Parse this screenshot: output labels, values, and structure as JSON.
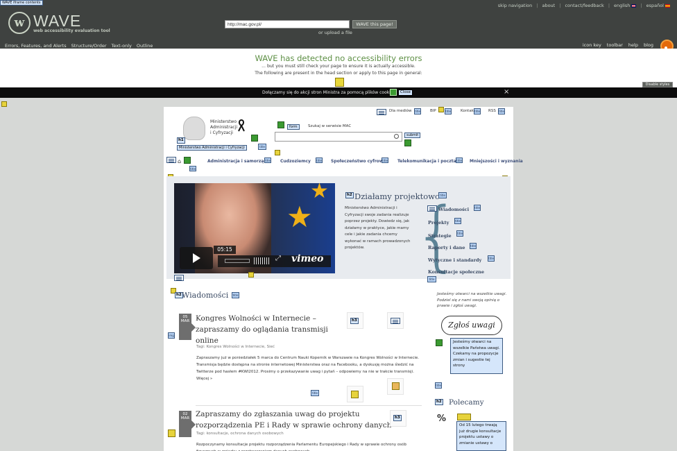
{
  "wave": {
    "logo_word": "WAVE",
    "logo_sub": "web accessibility evaluation tool",
    "top_links": [
      "skip navigation",
      "about",
      "contact/feedback",
      "english",
      "español"
    ],
    "url_value": "http://mac.gov.pl/",
    "submit_label": "WAVE this page!",
    "upload_link": "or upload a file",
    "nav_left": [
      "Errors, Features, and Alerts",
      "Structure/Order",
      "Text-only",
      "Outline"
    ],
    "nav_right": [
      "icon key",
      "toolbar",
      "help",
      "blog"
    ],
    "summary_title": "WAVE has detected no accessibility errors",
    "summary_sub": "... but you must still check your page to ensure it is actually accessible.",
    "summary_head": "The following are present in the head section or apply to this page in general:",
    "disable_label": "Disable styles",
    "colors": {
      "header_bg": "#3f4240",
      "success": "#5d8f44",
      "alert": "#e7d33c",
      "feature": "#3b9a31",
      "structure": "#b7d3f5"
    }
  },
  "cookie": {
    "text": "Dołączamy się do akcji stron Ministra za pomocą plików cookies",
    "close_tag": "Close"
  },
  "ministry": {
    "name_lines": [
      "Ministerstwo",
      "Administracji",
      "i Cyfryzacji"
    ],
    "h1_tag": "Ministerstwo Administracji i Cyfryzacji",
    "top_nav": [
      "Dla mediów",
      "BIP",
      "Kontakt",
      "RSS"
    ],
    "search_label_tag": "form",
    "search_label": "Szukaj w serwisie MAC",
    "search_button_tag": "submit",
    "main_nav": [
      "Administracja i samorząd",
      "Cudzoziemcy",
      "Społeczeństwo cyfrowe",
      "Telekomunikacja i poczta",
      "Mniejszości i wyznania"
    ]
  },
  "hero": {
    "title": "Działamy projektowo",
    "text": "Ministerstwo Administracji i Cyfryzacji swoje zadania realizuje poprzez projekty. Dowiedz się, jak działamy w praktyce, jakie mamy cele i jakie zadania chcemy wykonać w ramach prowadzonych projektów.",
    "links": [
      "Wiadomości",
      "Projekty",
      "Strategie",
      "Raporty i dane",
      "Wytyczne i standardy",
      "Konsultacje społeczne"
    ],
    "video_time": "05:15",
    "video_brand": "vimeo",
    "iframe_tag": "WAVE iframe contents"
  },
  "news": {
    "title": "Wiadomości",
    "items": [
      {
        "date_day": "05",
        "date_mon": "MAR",
        "head_lines": [
          "Kongres Wolności w Internecie –",
          "zapraszamy do oglądania transmisji",
          "online"
        ],
        "tags": "Tagi: Kongres Wolności w Internecie, Sieć",
        "body": "Zapraszamy już w poniedziałek 5 marca do Centrum Nauki Kopernik w Warszawie na Kongres Wolności w Internecie. Transmisja będzie dostępna na stronie internetowej Ministerstwa oraz na Facebooku, a dyskusję można śledzić na Twitterze pod hasłem #KWI2012. Prosimy o przekazywanie uwag i pytań – odpowiemy na nie w trakcie transmisji. Więcej »"
      },
      {
        "date_day": "02",
        "date_mon": "MAR",
        "head_lines": [
          "Zapraszamy do zgłaszania uwag do projektu",
          "rozporządzenia PE i Rady w sprawie ochrony danych"
        ],
        "tags": "Tagi: konsultacje, ochrona danych osobowych",
        "body": "Rozpoczynamy konsultacje projektu rozporządzenia Parlamentu Europejskiego i Rady w sprawie ochrony osób fizycznych w związku z przetwarzaniem danych osobowych."
      }
    ]
  },
  "sidebar": {
    "hand_text": "Jesteśmy otwarci na wszelkie uwagi. Podziel się z nami swoją opinią o prawie i zgłoś uwagi.",
    "zglos": "Zgłoś uwagi",
    "info_box": "Jesteśmy otwarci na wszelkie Państwa uwagi. Czekamy na propozycje zmian i sugestie tej strony",
    "polecamy": "Polecamy",
    "info_box2": "Od 15 lutego trwają już drugie konsultacje projektu ustawy o zmianie ustawy o"
  },
  "wave_tags": {
    "h1": "h1",
    "h2": "h2",
    "h3": "h3",
    "title": "title",
    "img": "img"
  }
}
